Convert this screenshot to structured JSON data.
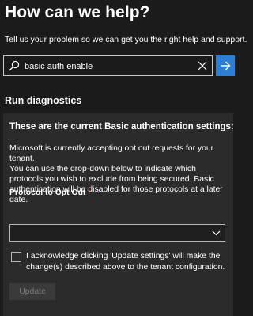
{
  "header": {
    "title": "How can we help?",
    "subtitle": "Tell us your problem so we can get you the right help and support."
  },
  "search": {
    "value": "basic auth enable",
    "icons": {
      "search": "search-icon",
      "clear": "close-icon",
      "submit": "arrow-right-icon"
    }
  },
  "diagnostics": {
    "heading": "Run diagnostics",
    "panel": {
      "title": "These are the current Basic authentication settings:",
      "paragraph1": "Microsoft is currently accepting opt out requests for your tenant.",
      "paragraph2": "You can use the drop-down below to indicate which protocols you wish to exclude from being secured. Basic authentication will be disabled for those protocols at a later date.",
      "field_label": "Protocol to Opt Out",
      "required_marker": "*",
      "dropdown_value": "",
      "checkbox_label": "I acknowledge clicking 'Update settings' will make the change(s) described above to the tenant configuration.",
      "checkbox_checked": false,
      "update_button": "Update"
    }
  },
  "colors": {
    "background": "#1b1b1b",
    "panel": "#2b2b2b",
    "accent": "#2b7fd4",
    "required": "#e74856",
    "disabled_text": "#7a7a7a"
  }
}
